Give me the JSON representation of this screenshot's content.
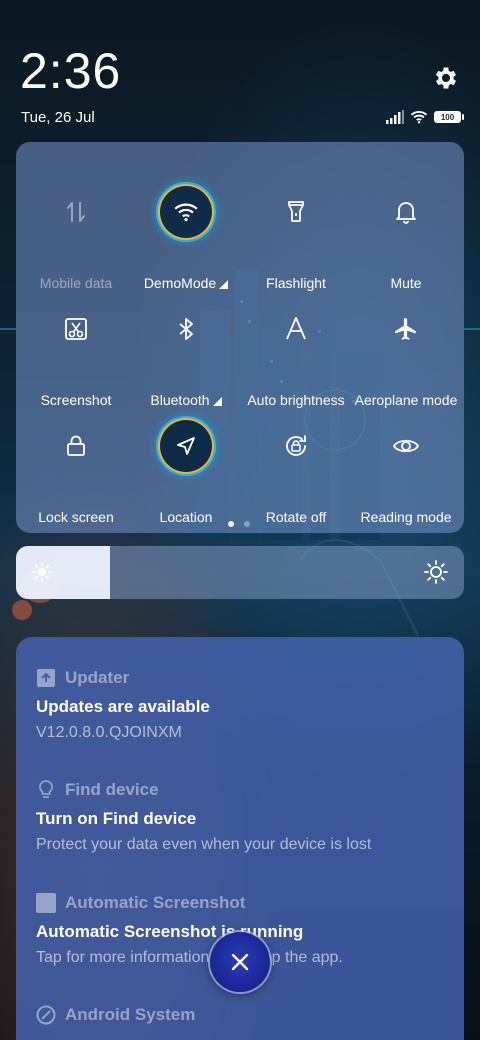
{
  "status": {
    "time": "2:36",
    "date": "Tue, 26 Jul",
    "battery": "100"
  },
  "quick_settings": {
    "tiles": [
      {
        "label": "Mobile data",
        "icon": "mobile-data-icon",
        "active": false,
        "disabled": true
      },
      {
        "label": "DemoMode",
        "icon": "wifi-icon",
        "active": true,
        "has_submenu": true
      },
      {
        "label": "Flashlight",
        "icon": "flashlight-icon",
        "active": false
      },
      {
        "label": "Mute",
        "icon": "bell-icon",
        "active": false
      },
      {
        "label": "Screenshot",
        "icon": "scissors-icon",
        "active": false
      },
      {
        "label": "Bluetooth",
        "icon": "bluetooth-icon",
        "active": false,
        "has_submenu": true
      },
      {
        "label": "Auto brightness",
        "icon": "auto-brightness-icon",
        "active": false
      },
      {
        "label": "Aeroplane mode",
        "icon": "airplane-icon",
        "active": false
      },
      {
        "label": "Lock screen",
        "icon": "lock-icon",
        "active": false
      },
      {
        "label": "Location",
        "icon": "location-arrow-icon",
        "active": true
      },
      {
        "label": "Rotate off",
        "icon": "rotate-lock-icon",
        "active": false
      },
      {
        "label": "Reading mode",
        "icon": "eye-icon",
        "active": false
      }
    ],
    "page_count": 2,
    "current_page": 1
  },
  "brightness": {
    "level": 0.21
  },
  "notifications": [
    {
      "app": "Updater",
      "icon": "updater-icon",
      "title": "Updates are available",
      "text": "V12.0.8.0.QJOINXM"
    },
    {
      "app": "Find device",
      "icon": "lightbulb-icon",
      "title": "Turn on Find device",
      "text": "Protect your data even when your device is lost"
    },
    {
      "app": "Automatic Screenshot",
      "icon": "app-square-icon",
      "title": "Automatic Screenshot is running",
      "text": "Tap for more information or to stop the app."
    },
    {
      "app": "Android System",
      "icon": "android-system-icon"
    }
  ],
  "colors": {
    "accent_ring_outer": "#f0b030",
    "accent_ring_inner": "#27b5e6",
    "notification_panel": "#4260aa"
  }
}
